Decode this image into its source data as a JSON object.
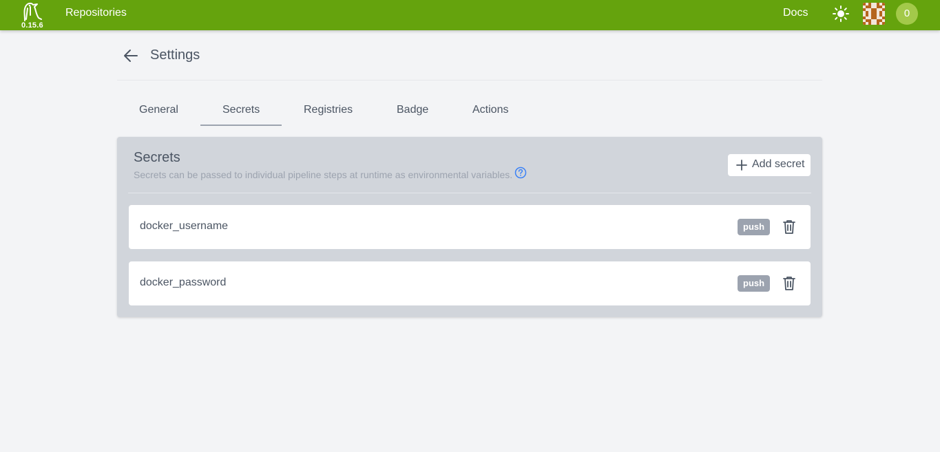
{
  "navbar": {
    "version": "0.15.6",
    "repositories_label": "Repositories",
    "docs_label": "Docs",
    "notification_count": "0",
    "brand_color": "#65a30d",
    "icons": [
      "woodpecker-logo-icon",
      "sun-icon",
      "avatar",
      "notification-badge"
    ]
  },
  "header": {
    "title": "Settings",
    "back_icon": "arrow-left-icon"
  },
  "tabs": [
    {
      "label": "General",
      "active": false
    },
    {
      "label": "Secrets",
      "active": true
    },
    {
      "label": "Registries",
      "active": false
    },
    {
      "label": "Badge",
      "active": false
    },
    {
      "label": "Actions",
      "active": false
    }
  ],
  "secrets_panel": {
    "title": "Secrets",
    "description": "Secrets can be passed to individual pipeline steps at runtime as environmental variables.",
    "help_icon": "question-circle-icon",
    "add_button_label": "Add secret",
    "add_icon": "plus-icon",
    "items": [
      {
        "name": "docker_username",
        "event": "push",
        "delete_icon": "trash-icon"
      },
      {
        "name": "docker_password",
        "event": "push",
        "delete_icon": "trash-icon"
      }
    ]
  }
}
